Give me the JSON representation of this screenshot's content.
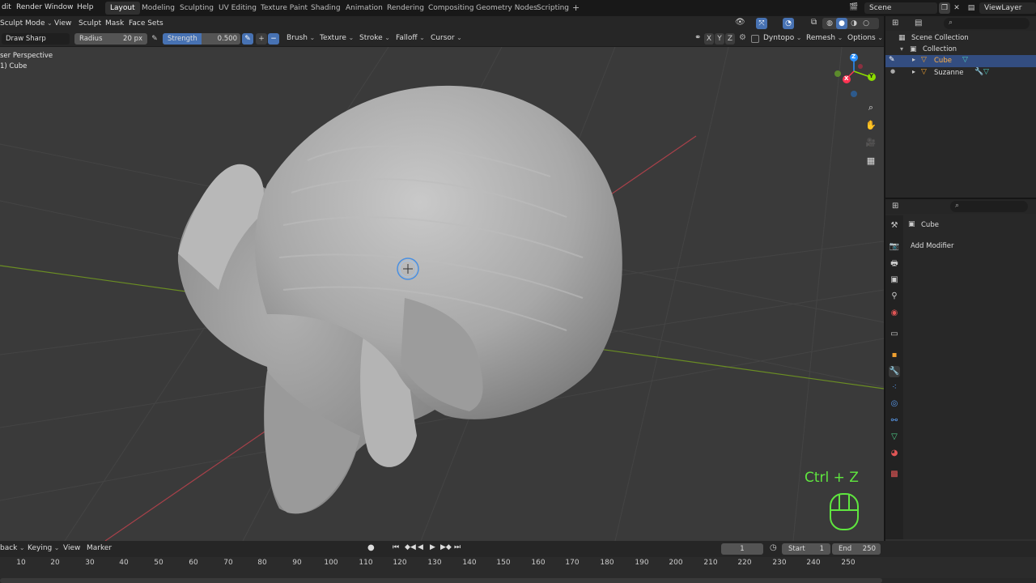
{
  "menubar": {
    "items": [
      "dit",
      "Render",
      "Window",
      "Help"
    ],
    "workspaces": [
      "Layout",
      "Modeling",
      "Sculpting",
      "UV Editing",
      "Texture Paint",
      "Shading",
      "Animation",
      "Rendering",
      "Compositing",
      "Geometry Nodes",
      "Scripting"
    ],
    "active_workspace": "Layout",
    "add_tab": "+",
    "scene": "Scene",
    "view_layer": "ViewLayer"
  },
  "header": {
    "mode": "Sculpt Mode",
    "menus": [
      "View",
      "Sculpt",
      "Mask",
      "Face Sets"
    ]
  },
  "toolsettings": {
    "tool": "Draw Sharp",
    "radius_label": "Radius",
    "radius_value": "20 px",
    "strength_label": "Strength",
    "strength_value": "0.500",
    "add_sub": [
      "+",
      "−"
    ],
    "menus": [
      "Brush",
      "Texture",
      "Stroke",
      "Falloff",
      "Cursor"
    ],
    "symmetry": [
      "X",
      "Y",
      "Z"
    ],
    "dyntopo": "Dyntopo",
    "remesh": "Remesh",
    "options": "Options"
  },
  "viewport": {
    "view_name": "ser Perspective",
    "object_name": "1) Cube",
    "gizmo_axes": {
      "x": "X",
      "y": "Y",
      "z": "Z"
    },
    "shortcut_overlay": "Ctrl + Z",
    "colors": {
      "x": "#ff3352",
      "y": "#8bdc00",
      "z": "#2890ff",
      "background": "#3a3a3a",
      "mesh": "#a9a9a9",
      "overlay": "#5fe63f"
    }
  },
  "outliner": {
    "root": "Scene Collection",
    "collection": "Collection",
    "objects": [
      "Cube",
      "Suzanne"
    ],
    "selected": "Cube"
  },
  "properties": {
    "object": "Cube",
    "add_modifier": "Add Modifier"
  },
  "timeline": {
    "menus": [
      "back",
      "Keying",
      "View",
      "Marker"
    ],
    "current_frame": "1",
    "start_label": "Start",
    "start_value": "1",
    "end_label": "End",
    "end_value": "250",
    "ticks": [
      "10",
      "20",
      "30",
      "40",
      "50",
      "60",
      "70",
      "80",
      "90",
      "100",
      "110",
      "120",
      "130",
      "140",
      "150",
      "160",
      "170",
      "180",
      "190",
      "200",
      "210",
      "220",
      "230",
      "240",
      "250"
    ]
  }
}
